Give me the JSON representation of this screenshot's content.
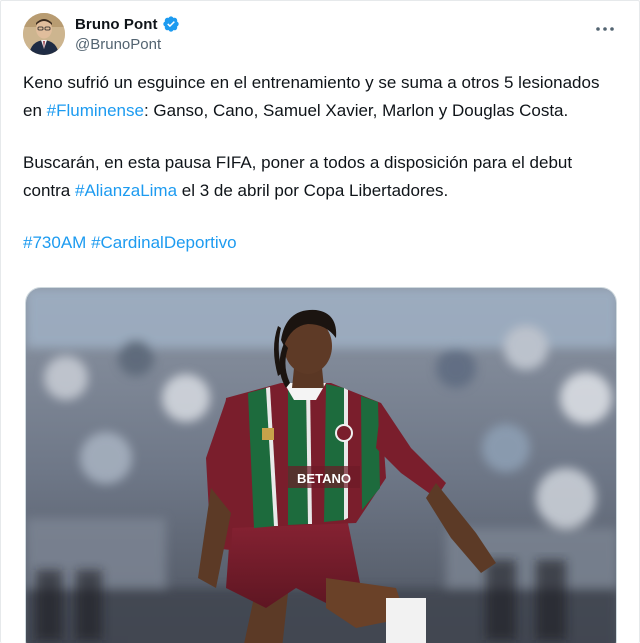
{
  "author": {
    "display_name": "Bruno Pont",
    "handle": "@BrunoPont",
    "verified": true
  },
  "icons": {
    "verified": "verified-badge-icon",
    "more": "more-options-icon"
  },
  "colors": {
    "link": "#1d9bf0",
    "text": "#0f1419",
    "secondary": "#536471",
    "verified": "#1d9bf0"
  },
  "tweet": {
    "p1": {
      "before": "Keno sufrió un esguince en el entrenamiento y se suma a otros 5 lesionados en ",
      "hashtag": "#Fluminense",
      "after": ": Ganso, Cano, Samuel Xavier, Marlon y Douglas Costa."
    },
    "p2": {
      "before": "Buscarán, en esta pausa FIFA, poner a todos a disposición para el debut contra ",
      "hashtag": "#AlianzaLima",
      "after": " el 3 de abril por Copa Libertadores."
    },
    "p3": {
      "hashtag1": "#730AM",
      "hashtag2": "#CardinalDeportivo"
    }
  },
  "media": {
    "jersey_text": "BETANO"
  }
}
